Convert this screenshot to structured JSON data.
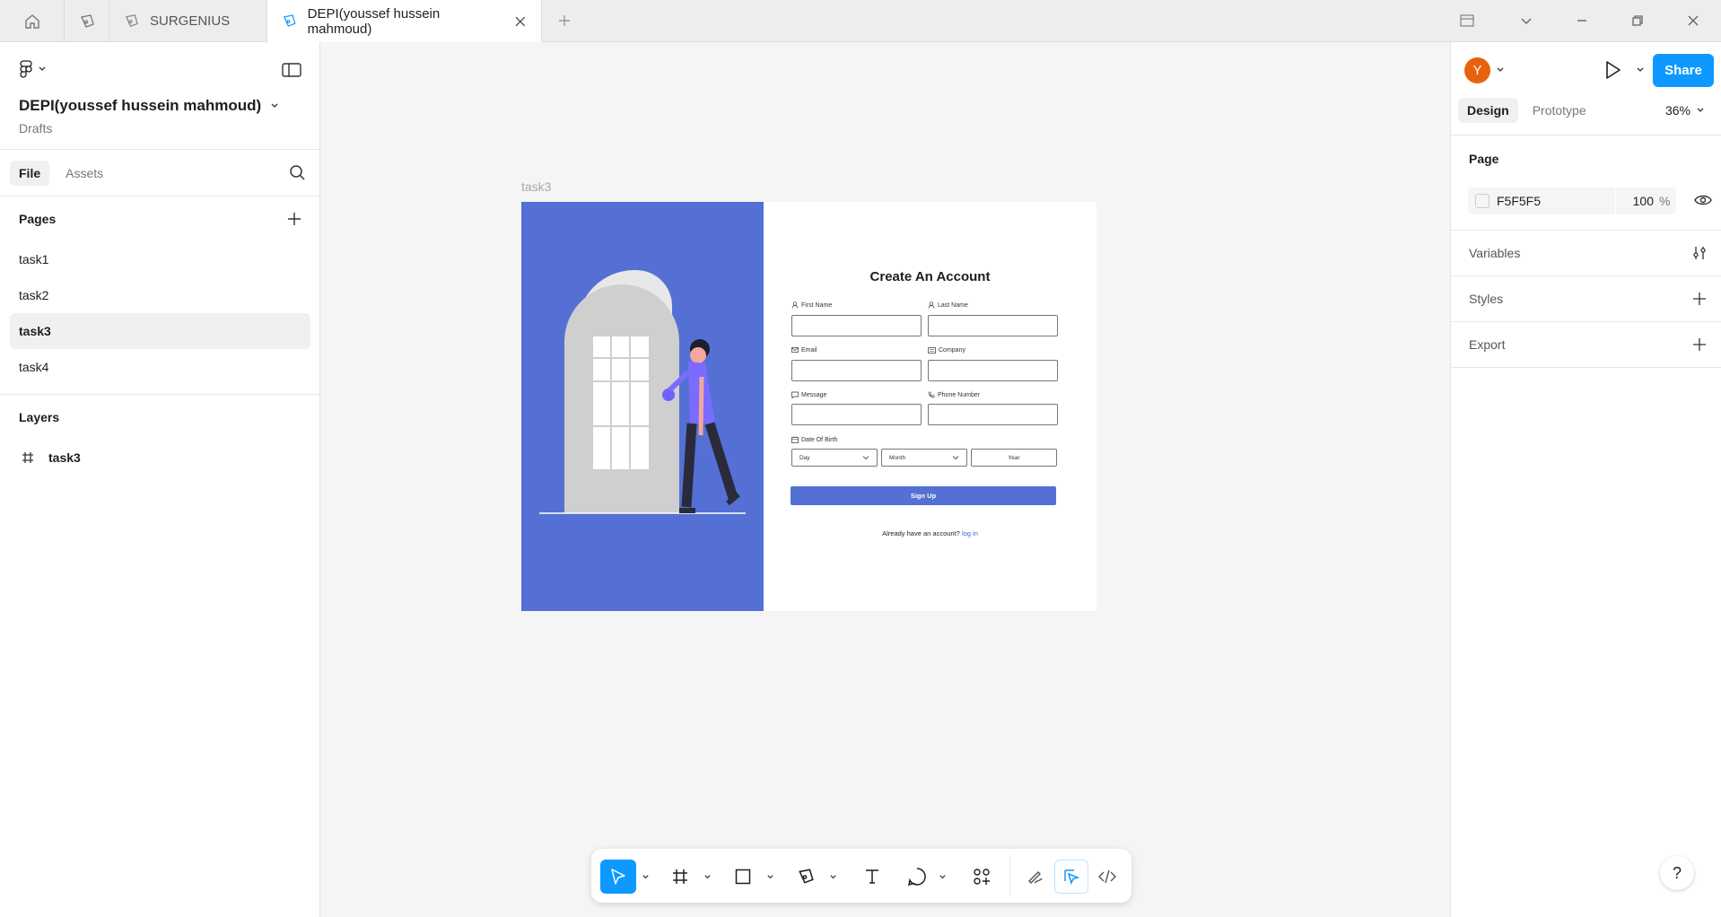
{
  "tabbar": {
    "tabs": [
      {
        "label": "SURGENIUS"
      },
      {
        "label": "DEPI(youssef hussein mahmoud)"
      }
    ]
  },
  "left_panel": {
    "file_title": "DEPI(youssef hussein mahmoud)",
    "file_location": "Drafts",
    "tabs": [
      "File",
      "Assets"
    ],
    "pages_title": "Pages",
    "pages": [
      "task1",
      "task2",
      "task3",
      "task4"
    ],
    "active_page": "task3",
    "layers_title": "Layers",
    "layers": [
      "task3"
    ]
  },
  "right_panel": {
    "avatar_initial": "Y",
    "avatar_color": "#e8620d",
    "share_label": "Share",
    "tabs": [
      "Design",
      "Prototype"
    ],
    "zoom": "36%",
    "page_label": "Page",
    "page_color": "F5F5F5",
    "page_opacity": "100",
    "page_opacity_unit": "%",
    "variables_label": "Variables",
    "styles_label": "Styles",
    "export_label": "Export"
  },
  "canvas": {
    "frame_name": "task3",
    "form": {
      "title": "Create An Account",
      "fields": [
        {
          "label": "First Name"
        },
        {
          "label": "Last Name"
        },
        {
          "label": "Email"
        },
        {
          "label": "Company"
        },
        {
          "label": "Message"
        },
        {
          "label": "Phone Number"
        }
      ],
      "dob_label": "Date Of Birth",
      "dob": {
        "day": "Day",
        "month": "Month",
        "year": "Year"
      },
      "submit_label": "Sign Up",
      "already_text": "Already have an account?",
      "login_text": "log in"
    },
    "accent_color": "#5470d4"
  },
  "help_label": "?",
  "colors": {
    "accent": "#0d99ff",
    "canvas_bg": "#f5f5f5"
  }
}
